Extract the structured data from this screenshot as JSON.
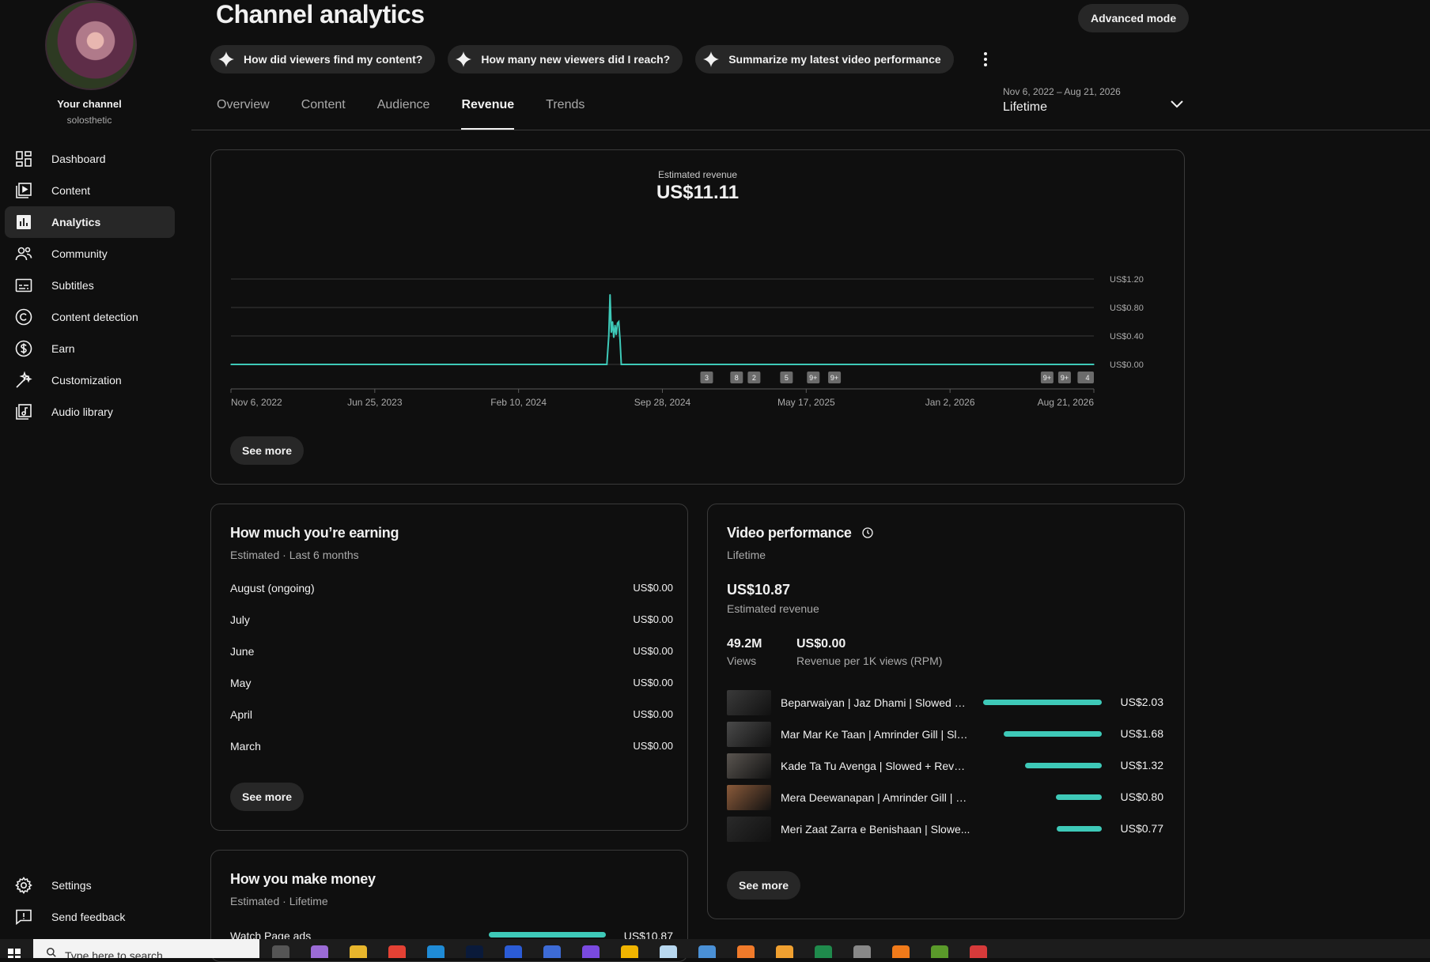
{
  "sidebar": {
    "channel_label": "Your channel",
    "channel_handle": "solosthetic",
    "items": [
      {
        "label": "Dashboard",
        "icon": "dashboard-icon"
      },
      {
        "label": "Content",
        "icon": "content-icon"
      },
      {
        "label": "Analytics",
        "icon": "analytics-icon",
        "active": true
      },
      {
        "label": "Community",
        "icon": "community-icon"
      },
      {
        "label": "Subtitles",
        "icon": "subtitles-icon"
      },
      {
        "label": "Content detection",
        "icon": "copyright-icon"
      },
      {
        "label": "Earn",
        "icon": "dollar-icon"
      },
      {
        "label": "Customization",
        "icon": "magic-wand-icon"
      },
      {
        "label": "Audio library",
        "icon": "audio-library-icon"
      }
    ],
    "footer": [
      {
        "label": "Settings",
        "icon": "gear-icon"
      },
      {
        "label": "Send feedback",
        "icon": "feedback-icon"
      }
    ]
  },
  "header": {
    "title": "Channel analytics",
    "advanced_mode": "Advanced mode",
    "chips": [
      "How did viewers find my content?",
      "How many new viewers did I reach?",
      "Summarize my latest video performance"
    ],
    "tabs": [
      "Overview",
      "Content",
      "Audience",
      "Revenue",
      "Trends"
    ],
    "active_tab": "Revenue",
    "date_range": "Nov 6, 2022 – Aug 21, 2026",
    "period": "Lifetime"
  },
  "revenue_card": {
    "label": "Estimated revenue",
    "value": "US$11.11",
    "see_more": "See more"
  },
  "chart_data": {
    "type": "line",
    "title": "Estimated revenue",
    "x_ticks": [
      "Nov 6, 2022",
      "Jun 25, 2023",
      "Feb 10, 2024",
      "Sep 28, 2024",
      "May 17, 2025",
      "Jan 2, 2026",
      "Aug 21, 2026"
    ],
    "y_ticks": [
      "US$0.00",
      "US$0.40",
      "US$0.80",
      "US$1.20"
    ],
    "ylim": [
      0,
      1.2
    ],
    "grid": true,
    "series": [
      {
        "color": "#3ec9b8",
        "points": [
          {
            "x": "2022-11-06",
            "y": 0.0
          },
          {
            "x": "2024-07-01",
            "y": 0.0
          },
          {
            "x": "2024-07-04",
            "y": 0.4
          },
          {
            "x": "2024-07-06",
            "y": 0.98
          },
          {
            "x": "2024-07-08",
            "y": 0.45
          },
          {
            "x": "2024-07-10",
            "y": 0.6
          },
          {
            "x": "2024-07-12",
            "y": 0.38
          },
          {
            "x": "2024-07-14",
            "y": 0.55
          },
          {
            "x": "2024-07-16",
            "y": 0.42
          },
          {
            "x": "2024-07-18",
            "y": 0.58
          },
          {
            "x": "2024-07-20",
            "y": 0.6
          },
          {
            "x": "2024-07-22",
            "y": 0.35
          },
          {
            "x": "2024-07-24",
            "y": 0.0
          },
          {
            "x": "2026-08-21",
            "y": 0.0
          }
        ]
      }
    ],
    "markers": [
      {
        "x": "2024-12-08",
        "label": "3"
      },
      {
        "x": "2025-01-25",
        "label": "8"
      },
      {
        "x": "2025-02-22",
        "label": "2"
      },
      {
        "x": "2025-04-15",
        "label": "5"
      },
      {
        "x": "2025-05-28",
        "label": "9+"
      },
      {
        "x": "2025-07-01",
        "label": "9+"
      },
      {
        "x": "2026-06-07",
        "label": "9+"
      },
      {
        "x": "2026-07-05",
        "label": "9+"
      },
      {
        "x": "2026-08-05",
        "label": "3"
      },
      {
        "x": "2026-08-21",
        "label": "4"
      }
    ]
  },
  "earnings": {
    "title": "How much you’re earning",
    "subtitle": "Estimated · Last 6 months",
    "rows": [
      {
        "month": "August (ongoing)",
        "value": "US$0.00"
      },
      {
        "month": "July",
        "value": "US$0.00"
      },
      {
        "month": "June",
        "value": "US$0.00"
      },
      {
        "month": "May",
        "value": "US$0.00"
      },
      {
        "month": "April",
        "value": "US$0.00"
      },
      {
        "month": "March",
        "value": "US$0.00"
      }
    ],
    "see_more": "See more"
  },
  "video_performance": {
    "title": "Video performance",
    "subtitle": "Lifetime",
    "revenue": "US$10.87",
    "revenue_label": "Estimated revenue",
    "views": "49.2M",
    "views_label": "Views",
    "rpm": "US$0.00",
    "rpm_label": "Revenue per 1K views (RPM)",
    "videos": [
      {
        "title": "Beparwaiyan | Jaz Dhami | Slowed + ...",
        "value": "US$2.03",
        "share": 1.0,
        "thumb": "#3a3a3a"
      },
      {
        "title": "Mar Mar Ke Taan | Amrinder Gill | Slo...",
        "value": "US$1.68",
        "share": 0.83,
        "thumb": "#4a4a4a"
      },
      {
        "title": "Kade Ta Tu Avenga | Slowed + Rever...",
        "value": "US$1.32",
        "share": 0.65,
        "thumb": "#5a5550"
      },
      {
        "title": "Mera Deewanapan | Amrinder Gill | Sl...",
        "value": "US$0.80",
        "share": 0.39,
        "thumb": "#8a5a3a"
      },
      {
        "title": "Meri Zaat Zarra e Benishaan | Slowe...",
        "value": "US$0.77",
        "share": 0.38,
        "thumb": "#2a2a2a"
      }
    ],
    "see_more": "See more"
  },
  "money": {
    "title": "How you make money",
    "subtitle": "Estimated · Lifetime",
    "rows": [
      {
        "label": "Watch Page ads",
        "value": "US$10.87",
        "share": 1.0
      }
    ]
  },
  "taskbar": {
    "search_placeholder": "Type here to search",
    "apps": [
      "#555555",
      "#9b6bd6",
      "#e8b62c",
      "#e44134",
      "#1f8bd6",
      "#0a1a3a",
      "#2b5cd6",
      "#3d6bd6",
      "#7a4ae0",
      "#f0b400",
      "#b8d8f0",
      "#4a90d6",
      "#f07a2a",
      "#f0a030",
      "#1f8a4c",
      "#888888",
      "#f07a1a",
      "#5a9a2a",
      "#d63a3a"
    ]
  }
}
